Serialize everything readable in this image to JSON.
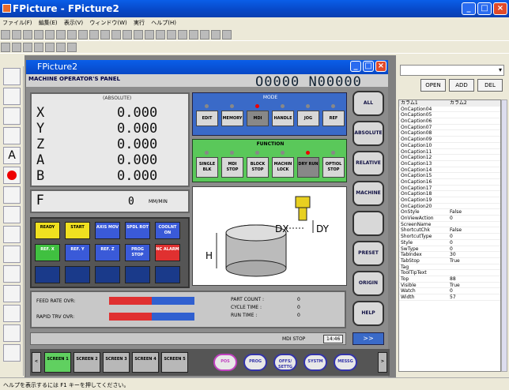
{
  "window": {
    "title": "FPicture - FPicture2"
  },
  "menu": [
    "ファイル(F)",
    "編集(E)",
    "表示(V)",
    "ウィンドウ(W)",
    "実行",
    "ヘルプ(H)"
  ],
  "form": {
    "title": "FPicture2"
  },
  "panel": {
    "header": "MACHINE OPERATOR'S PANEL",
    "program_number": "O0000",
    "sequence_number": "N00000",
    "abs_title": "(ABSOLUTE)",
    "axes": [
      {
        "label": "X",
        "value": "0.000"
      },
      {
        "label": "Y",
        "value": "0.000"
      },
      {
        "label": "Z",
        "value": "0.000"
      },
      {
        "label": "A",
        "value": "0.000"
      },
      {
        "label": "B",
        "value": "0.000"
      }
    ],
    "feed": {
      "label": "F",
      "value": "0",
      "unit": "MM/MIN"
    },
    "status_buttons": [
      {
        "label": "READY",
        "color": "#f0e020"
      },
      {
        "label": "START",
        "color": "#f0e020"
      },
      {
        "label": "AXIS MOV",
        "color": "#3a5ad8"
      },
      {
        "label": "SPDL ROT",
        "color": "#3a5ad8"
      },
      {
        "label": "COOLNT ON",
        "color": "#3a5ad8"
      },
      {
        "label": "REF. X",
        "color": "#40c040"
      },
      {
        "label": "REF. Y",
        "color": "#3a5ad8"
      },
      {
        "label": "REF. Z",
        "color": "#3a5ad8"
      },
      {
        "label": "PROG STOP",
        "color": "#3a5ad8"
      },
      {
        "label": "NC ALARM",
        "color": "#e03030"
      }
    ],
    "mode_title": "MODE",
    "modes": [
      "EDIT",
      "MEMORY",
      "MDI",
      "HANDLE",
      "JOG",
      "REF"
    ],
    "function_title": "FUNCTION",
    "functions": [
      "SINGLE BLK",
      "MDI STOP",
      "BLOCK STOP",
      "MACHIN LOCK",
      "DRY RUN",
      "OPTIOL STOP"
    ],
    "diagram": {
      "dx": "DX",
      "dy": "DY",
      "h": "H"
    },
    "right_buttons": [
      "ALL",
      "ABSOLUTE",
      "RELATIVE",
      "MACHINE",
      "",
      "PRESET",
      "ORIGIN",
      "HELP"
    ],
    "feed_rate_ovr": "FEED RATE OVR:",
    "rapid_trv_ovr": "RAPID TRV OVR:",
    "part_count": "PART COUNT :",
    "cycle_time": "CYCLE TIME :",
    "run_time": "RUN TIME :",
    "part_count_val": "0",
    "cycle_time_val": "0",
    "run_time_val": "0",
    "info_mode": "MDI STOP",
    "info_time": "14:46",
    "next_label": ">>",
    "screens": [
      "SCREEN 1",
      "SCREEN 2",
      "SCREEN 3",
      "SCREEN 4",
      "SCREEN 5"
    ],
    "soft_keys": [
      "POS",
      "PROG",
      "OFFS/ SETTG",
      "SYSTM",
      "MESSG"
    ],
    "prev_arrow": "<",
    "next_arrow": ">"
  },
  "properties": {
    "buttons": [
      "OPEN",
      "ADD",
      "DEL"
    ],
    "col1": "カラム1",
    "col2": "カラム2",
    "rows": [
      [
        "OnCaption04",
        ""
      ],
      [
        "OnCaption05",
        ""
      ],
      [
        "OnCaption06",
        ""
      ],
      [
        "OnCaption07",
        ""
      ],
      [
        "OnCaption08",
        ""
      ],
      [
        "OnCaption09",
        ""
      ],
      [
        "OnCaption10",
        ""
      ],
      [
        "OnCaption11",
        ""
      ],
      [
        "OnCaption12",
        ""
      ],
      [
        "OnCaption13",
        ""
      ],
      [
        "OnCaption14",
        ""
      ],
      [
        "OnCaption15",
        ""
      ],
      [
        "OnCaption16",
        ""
      ],
      [
        "OnCaption17",
        ""
      ],
      [
        "OnCaption18",
        ""
      ],
      [
        "OnCaption19",
        ""
      ],
      [
        "OnCaption20",
        ""
      ],
      [
        "OnStyle",
        "False"
      ],
      [
        "OnViewAction",
        "0"
      ],
      [
        "ScreenName",
        ""
      ],
      [
        "ShortcutChk",
        "False"
      ],
      [
        "ShortcutType",
        "0"
      ],
      [
        "Style",
        "0"
      ],
      [
        "SwType",
        "0"
      ],
      [
        "TabIndex",
        "30"
      ],
      [
        "TabStop",
        "True"
      ],
      [
        "Tag",
        ""
      ],
      [
        "ToolTipText",
        ""
      ],
      [
        "Top",
        "88"
      ],
      [
        "Visible",
        "True"
      ],
      [
        "Watch",
        "0"
      ],
      [
        "Width",
        "57"
      ]
    ]
  },
  "statusbar": "ヘルプを表示するには F1 キーを押してください。"
}
